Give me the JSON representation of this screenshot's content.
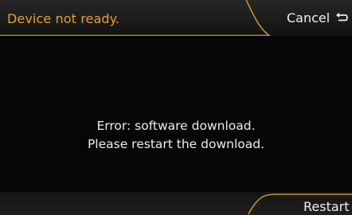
{
  "header": {
    "title": "Device not ready.",
    "cancel_label": "Cancel"
  },
  "dialog": {
    "line1": "Error: software download.",
    "line2": "Please restart the download."
  },
  "footer": {
    "restart_label": "Restart"
  },
  "icons": {
    "cancel": "return-arrow-icon"
  },
  "colors": {
    "title": "#e2a230",
    "accent_line": "#c8922c",
    "background": "#060606"
  }
}
